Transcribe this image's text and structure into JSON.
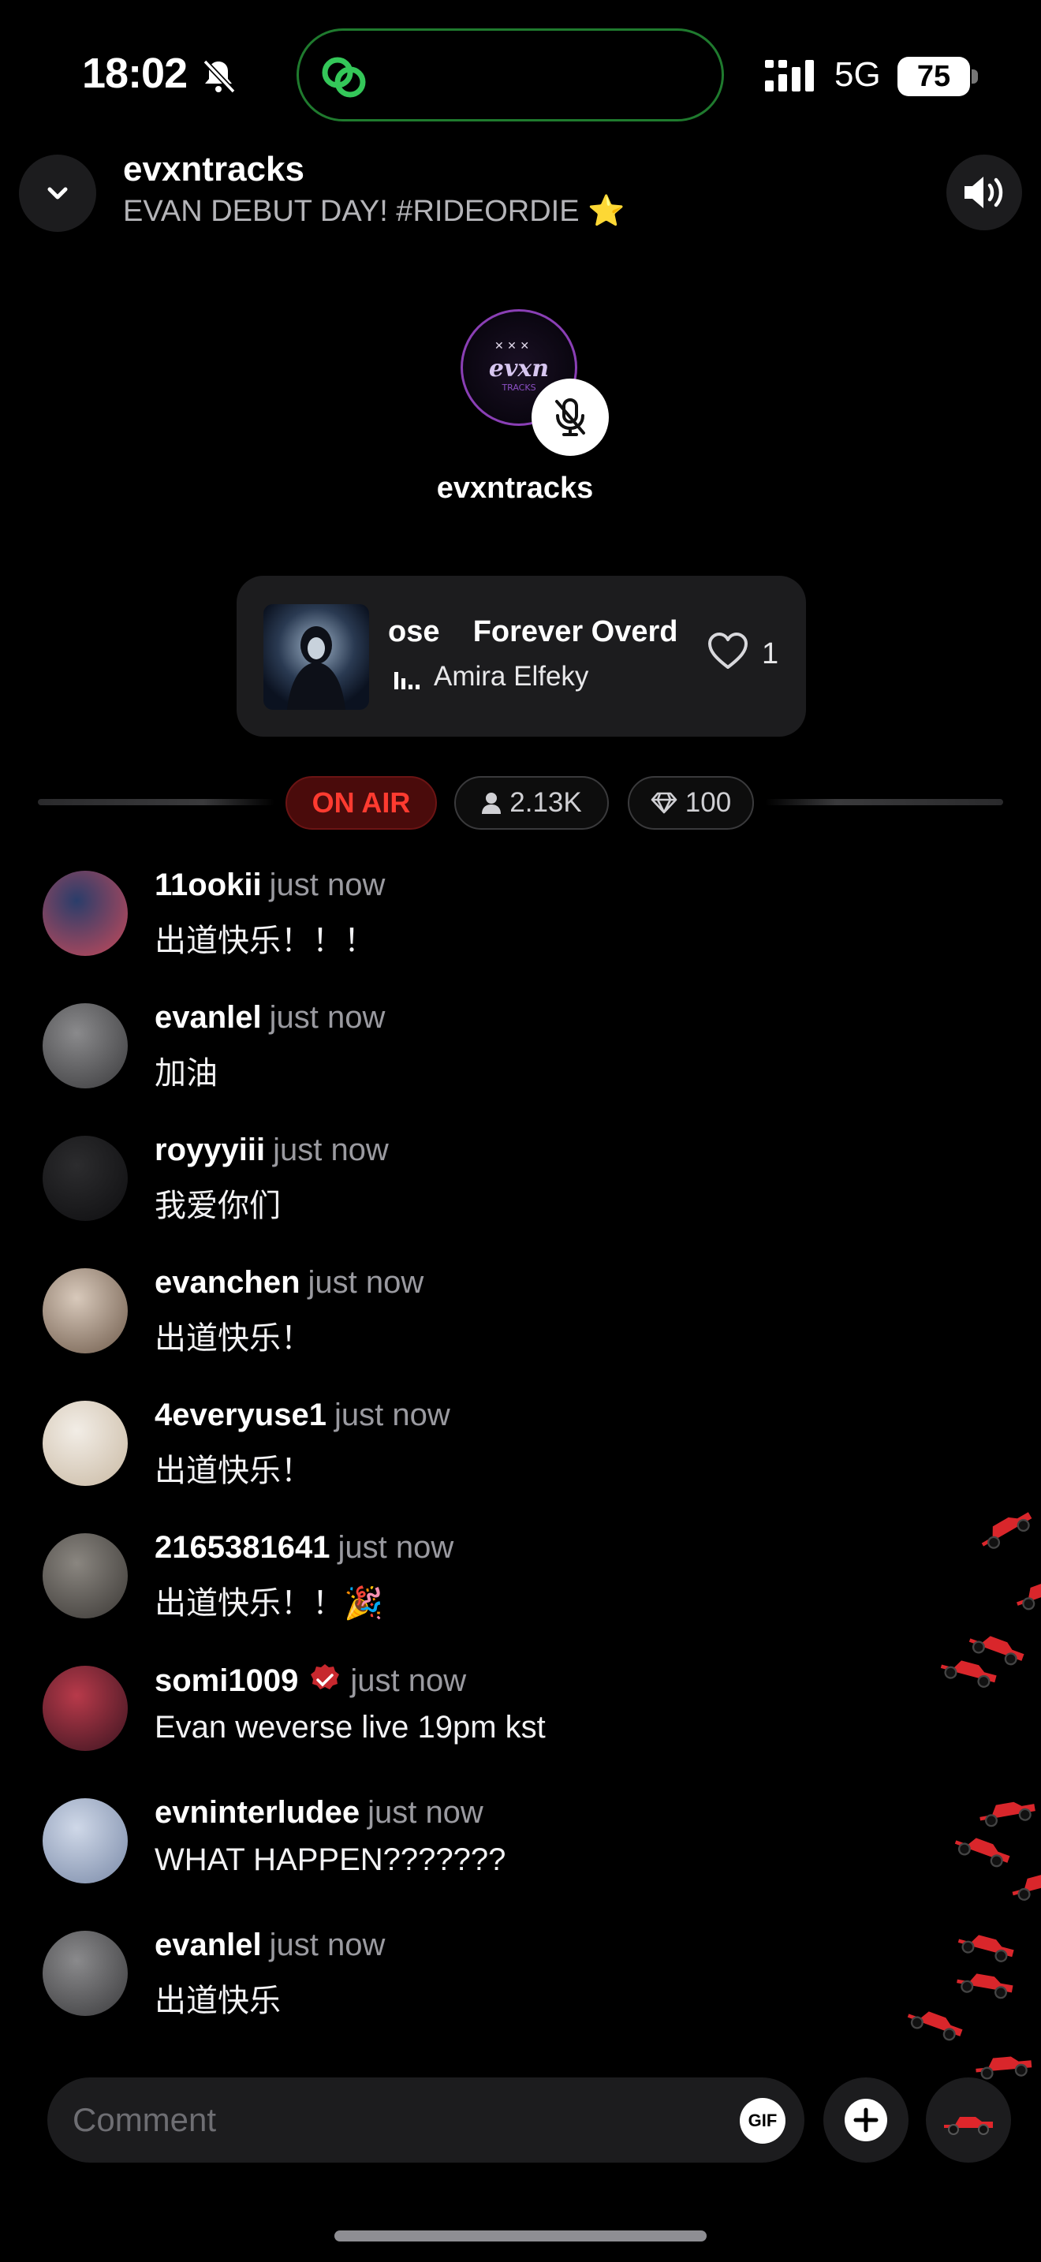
{
  "status_bar": {
    "time": "18:02",
    "network": "5G",
    "battery": "75"
  },
  "header": {
    "host": "evxntracks",
    "title": "EVAN DEBUT DAY! #RIDEORDIE ⭐️"
  },
  "host": {
    "name": "evxntracks",
    "avatar_text": "evxntracks",
    "avatar_subtext": "TRACKS"
  },
  "music": {
    "title": "ose    Forever Overd",
    "artist": "Amira Elfeky",
    "likes": "1"
  },
  "stats": {
    "on_air": "ON AIR",
    "listeners": "2.13K",
    "diamonds": "100"
  },
  "comments": [
    {
      "user": "11ookii",
      "time": "just now",
      "text": "出道快乐！！！",
      "avatar": [
        "#2a3d6a",
        "#c84a5a"
      ]
    },
    {
      "user": "evanlel",
      "time": "just now",
      "text": "加油",
      "avatar": [
        "#8a8a8c",
        "#3a3a3c"
      ]
    },
    {
      "user": "royyyiii",
      "time": "just now",
      "text": "我爱你们",
      "avatar": [
        "#2c2c2e",
        "#0e0e10"
      ]
    },
    {
      "user": "evanchen",
      "time": "just now",
      "text": "出道快乐！",
      "avatar": [
        "#d8c9bb",
        "#6e5a4a"
      ]
    },
    {
      "user": "4everyuse1",
      "time": "just now",
      "text": "出道快乐！",
      "avatar": [
        "#f2ede6",
        "#c9b9a3"
      ]
    },
    {
      "user": "2165381641",
      "time": "just now",
      "text": "出道快乐！！🎉",
      "avatar": [
        "#8a8680",
        "#3b3835"
      ]
    },
    {
      "user": "somi1009",
      "time": "just now",
      "text": "Evan weverse live 19pm kst",
      "avatar": [
        "#b83a4a",
        "#3a1420"
      ],
      "badge": true
    },
    {
      "user": "evninterludee",
      "time": "just now",
      "text": "WHAT HAPPEN???????",
      "avatar": [
        "#cfd8e8",
        "#7a8aa8"
      ]
    },
    {
      "user": "evanlel",
      "time": "just now",
      "text": "出道快乐",
      "avatar": [
        "#8a8a8c",
        "#3a3a3c"
      ]
    }
  ],
  "input": {
    "placeholder": "Comment",
    "gif": "GIF"
  },
  "colors": {
    "accent_red": "#ff3b30",
    "island_green": "#34c759",
    "card": "#1c1c1e"
  },
  "icons": [
    "bell-slash-icon",
    "link-icon",
    "signal-icon",
    "chevron-down-icon",
    "speaker-icon",
    "mic-slash-icon",
    "heart-icon",
    "person-icon",
    "diamond-icon",
    "plus-icon",
    "race-car-icon"
  ]
}
